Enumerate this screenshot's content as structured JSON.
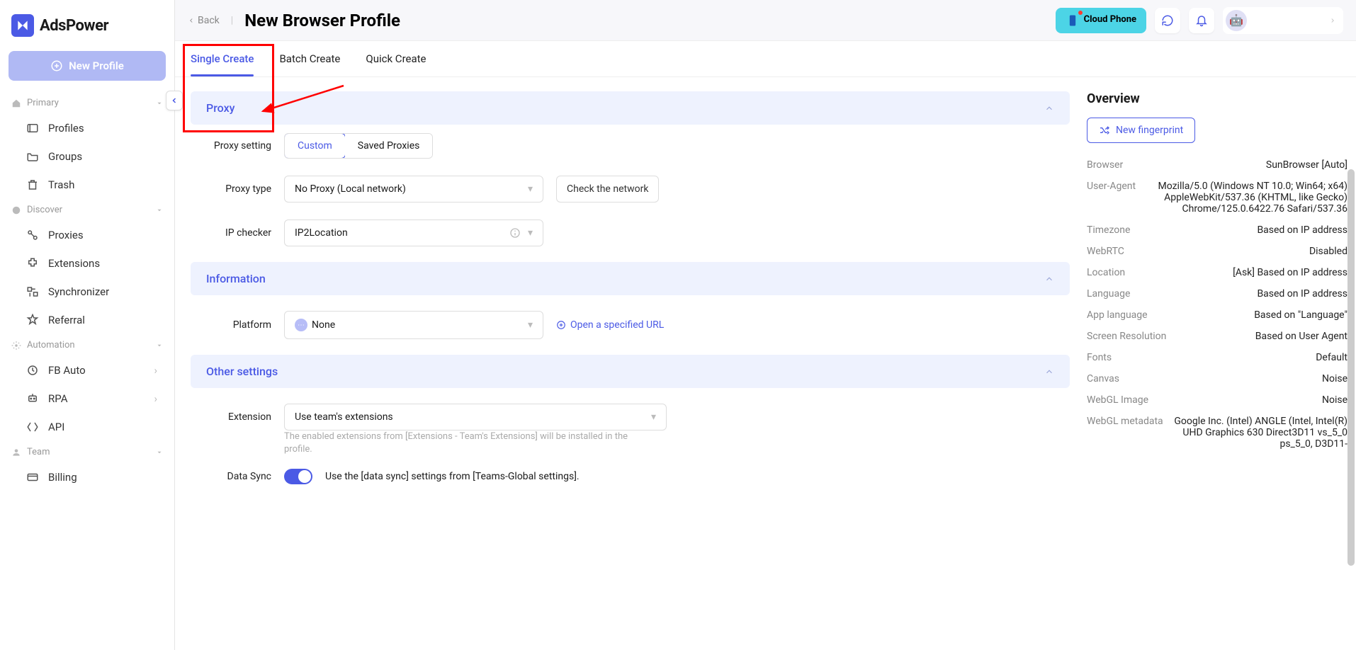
{
  "brand": "AdsPower",
  "header": {
    "back": "Back",
    "title": "New Browser Profile",
    "cloud_phone": "Cloud Phone"
  },
  "sidebar": {
    "new_profile": "New Profile",
    "sections": {
      "primary": {
        "label": "Primary",
        "items": [
          {
            "label": "Profiles"
          },
          {
            "label": "Groups"
          },
          {
            "label": "Trash"
          }
        ]
      },
      "discover": {
        "label": "Discover",
        "items": [
          {
            "label": "Proxies"
          },
          {
            "label": "Extensions"
          },
          {
            "label": "Synchronizer"
          },
          {
            "label": "Referral"
          }
        ]
      },
      "automation": {
        "label": "Automation",
        "items": [
          {
            "label": "FB Auto"
          },
          {
            "label": "RPA"
          },
          {
            "label": "API"
          }
        ]
      },
      "team": {
        "label": "Team",
        "items": [
          {
            "label": "Billing"
          }
        ]
      }
    }
  },
  "tabs": {
    "single": "Single Create",
    "batch": "Batch Create",
    "quick": "Quick Create"
  },
  "sections": {
    "proxy": "Proxy",
    "information": "Information",
    "other": "Other settings"
  },
  "form": {
    "proxy_setting_label": "Proxy setting",
    "proxy_setting_custom": "Custom",
    "proxy_setting_saved": "Saved Proxies",
    "proxy_type_label": "Proxy type",
    "proxy_type_value": "No Proxy (Local network)",
    "check_network": "Check the network",
    "ip_checker_label": "IP checker",
    "ip_checker_value": "IP2Location",
    "platform_label": "Platform",
    "platform_value": "None",
    "open_url": "Open a specified URL",
    "extension_label": "Extension",
    "extension_value": "Use team's extensions",
    "extension_hint": "The enabled extensions from [Extensions - Team's Extensions] will be installed in the profile.",
    "data_sync_label": "Data Sync",
    "data_sync_text": "Use the [data sync] settings from [Teams-Global settings]."
  },
  "overview": {
    "title": "Overview",
    "new_fingerprint": "New fingerprint",
    "rows": [
      {
        "label": "Browser",
        "value": "SunBrowser [Auto]"
      },
      {
        "label": "User-Agent",
        "value": "Mozilla/5.0 (Windows NT 10.0; Win64; x64) AppleWebKit/537.36 (KHTML, like Gecko) Chrome/125.0.6422.76 Safari/537.36"
      },
      {
        "label": "Timezone",
        "value": "Based on IP address"
      },
      {
        "label": "WebRTC",
        "value": "Disabled"
      },
      {
        "label": "Location",
        "value": "[Ask] Based on IP address"
      },
      {
        "label": "Language",
        "value": "Based on IP address"
      },
      {
        "label": "App language",
        "value": "Based on \"Language\""
      },
      {
        "label": "Screen Resolution",
        "value": "Based on User Agent"
      },
      {
        "label": "Fonts",
        "value": "Default"
      },
      {
        "label": "Canvas",
        "value": "Noise"
      },
      {
        "label": "WebGL Image",
        "value": "Noise"
      },
      {
        "label": "WebGL metadata",
        "value": "Google Inc. (Intel) ANGLE (Intel, Intel(R) UHD Graphics 630 Direct3D11 vs_5_0 ps_5_0, D3D11-"
      }
    ]
  }
}
